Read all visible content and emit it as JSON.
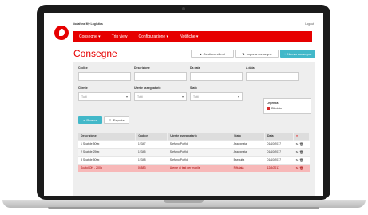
{
  "header": {
    "user": "Vodafone My Logistics",
    "logout": "Logout"
  },
  "nav": {
    "items": [
      "Consegne ▾",
      "Trip view",
      "Configurazione ▾",
      "Notifiche ▾"
    ]
  },
  "page": {
    "title": "Consegne"
  },
  "actions": {
    "clients": "Gestione clienti",
    "import": "Importa consegne",
    "new": "Nuova consegna"
  },
  "filters": {
    "codice": "Codice",
    "descrizione": "Descrizione",
    "da_data": "Da data",
    "a_data": "A data",
    "cliente": "Cliente",
    "utente": "Utente assegnatario",
    "stato": "Stato",
    "cliente_value": "Tutti",
    "utente_value": "Tutti",
    "stato_value": "Tutti"
  },
  "legend": {
    "title": "Legenda",
    "item": "Rifiutata",
    "color": "#d62b2b"
  },
  "buttons": {
    "search": "Ricerca",
    "export": "Esporta"
  },
  "table": {
    "headers": [
      "Descrizione",
      "Codice",
      "Utente assegnatario",
      "Stato",
      "Data"
    ],
    "rows": [
      {
        "desc": "1 Scatole 500g",
        "code": "12347",
        "user": "Stefano Porfidi",
        "status": "Assegnata",
        "date": "01/10/2017"
      },
      {
        "desc": "2 Scatole 250g",
        "code": "12345",
        "user": "Stefano Porfidi",
        "status": "Assegnata",
        "date": "01/10/2017"
      },
      {
        "desc": "3 Scatole 500g",
        "code": "12348",
        "user": "Stefano Porfidi",
        "status": "Eseguita",
        "date": "01/10/2017"
      },
      {
        "desc": "Scatol ON - 200g",
        "code": "06583",
        "user": "Utente di test per mobile",
        "status": "Rifiutata",
        "date": "12/9/2017"
      }
    ]
  }
}
